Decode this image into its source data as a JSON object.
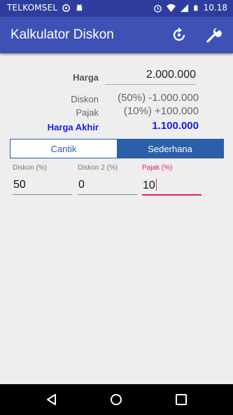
{
  "status_bar": {
    "carrier": "TELKOMSEL",
    "time": "10.18"
  },
  "app_bar": {
    "title": "Kalkulator Diskon",
    "actions": [
      "reset-icon",
      "wrench-icon"
    ]
  },
  "summary": {
    "harga_label": "Harga",
    "harga_value": "2.000.000",
    "diskon_label": "Diskon",
    "diskon_value": "(50%) -1.000.000",
    "pajak_label": "Pajak",
    "pajak_value": "(10%) +100.000",
    "akhir_label": "Harga Akhir",
    "akhir_value": "1.100.000"
  },
  "tabs": [
    {
      "label": "Cantik",
      "selected": false
    },
    {
      "label": "Sederhana",
      "selected": true
    }
  ],
  "fields": [
    {
      "label": "Diskon (%)",
      "value": "50"
    },
    {
      "label": "Diskon 2 (%)",
      "value": "0"
    },
    {
      "label": "Pajak (%)",
      "value": "10",
      "focused": true
    }
  ],
  "colors": {
    "status_bar": "#2f3e9e",
    "app_bar": "#3f51b5",
    "accent": "#e91e63",
    "total": "#1a1aee",
    "tab_selected": "#2b5fa8"
  },
  "nav_bar": [
    "back-icon",
    "home-icon",
    "recents-icon"
  ]
}
